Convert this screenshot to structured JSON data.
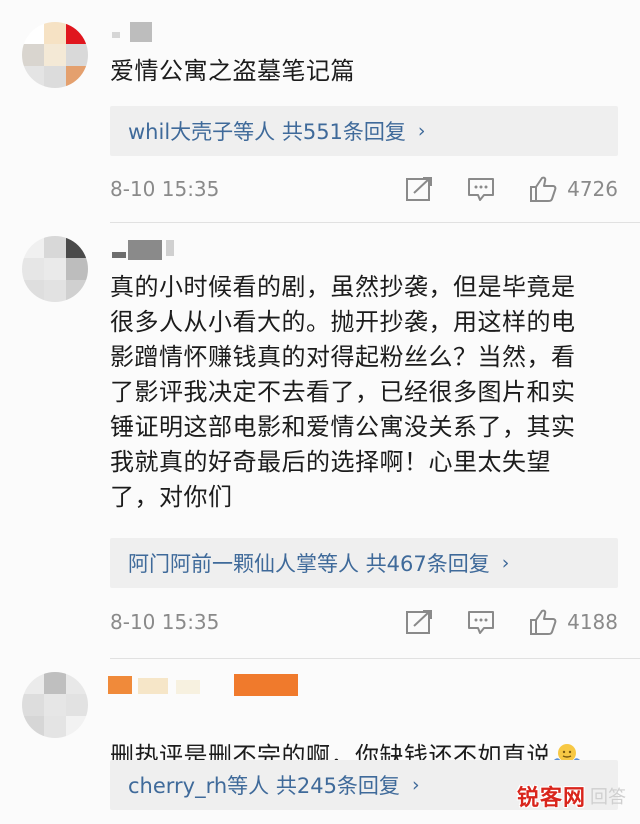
{
  "comments": [
    {
      "content": "爱情公寓之盗墓笔记篇",
      "replies": {
        "text": "whil大壳子等人 共551条回复"
      },
      "meta": {
        "time": "8-10 15:35",
        "likes": "4726"
      }
    },
    {
      "content": "真的小时候看的剧，虽然抄袭，但是毕竟是\n很多人从小看大的。抛开抄袭，用这样的电\n影蹭情怀赚钱真的对得起粉丝么？当然，看\n了影评我决定不去看了，已经很多图片和实\n锤证明这部电影和爱情公寓没关系了，其实\n我就真的好奇最后的选择啊！心里太失望\n了，对你们",
      "replies": {
        "text": "阿门阿前一颗仙人掌等人 共467条回复"
      },
      "meta": {
        "time": "8-10 15:35",
        "likes": "4188"
      }
    },
    {
      "content": "删热评是删不完的啊，你缺钱还不如直说",
      "replies": {
        "text": "cherry_rh等人 共245条回复"
      }
    }
  ],
  "icons": {
    "chevron": "›",
    "share": "share-icon",
    "comment": "comment-icon",
    "like": "thumbs-up-icon"
  },
  "watermark": {
    "logo": "锐客网",
    "dim": "回答"
  },
  "colors": {
    "link": "#3f6a9a",
    "meta": "#8a8a8a",
    "reply_bg": "#efefef",
    "watermark": "#d9251c"
  }
}
